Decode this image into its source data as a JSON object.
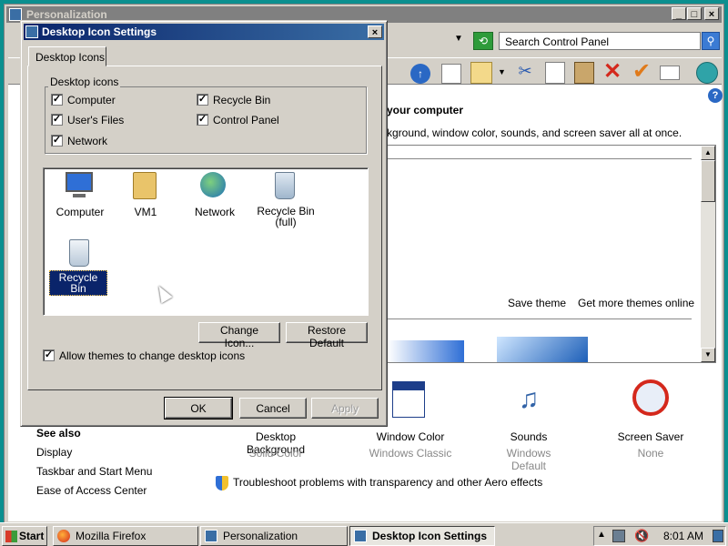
{
  "personalization_window": {
    "title": "Personalization",
    "search_placeholder": "Search Control Panel",
    "heading": "your computer",
    "subheading": "kground, window color, sounds, and screen saver all at once.",
    "save_theme": "Save theme",
    "more_themes": "Get more themes online",
    "see_also_heading": "See also",
    "see_also": [
      "Display",
      "Taskbar and Start Menu",
      "Ease of Access Center"
    ],
    "settings": [
      {
        "label": "Desktop Background",
        "value": "Solid Color",
        "icon": "desktop-background-icon"
      },
      {
        "label": "Window Color",
        "value": "Windows Classic",
        "icon": "window-color-icon"
      },
      {
        "label": "Sounds",
        "value": "Windows Default",
        "icon": "sounds-icon"
      },
      {
        "label": "Screen Saver",
        "value": "None",
        "icon": "screen-saver-icon"
      }
    ],
    "troubleshoot_link": "Troubleshoot problems with transparency and other Aero effects"
  },
  "dialog": {
    "title": "Desktop Icon Settings",
    "tab_label": "Desktop Icons",
    "group_label": "Desktop icons",
    "checkboxes": [
      {
        "label": "Computer",
        "checked": true
      },
      {
        "label": "Recycle Bin",
        "checked": true
      },
      {
        "label": "User's Files",
        "checked": true
      },
      {
        "label": "Control Panel",
        "checked": true
      },
      {
        "label": "Network",
        "checked": true
      }
    ],
    "icons": [
      {
        "label": "Computer",
        "icon": "computer-icon"
      },
      {
        "label": "VM1",
        "icon": "user-folder-icon"
      },
      {
        "label": "Network",
        "icon": "network-icon"
      },
      {
        "label": "Recycle Bin (full)",
        "icon": "recycle-bin-full-icon"
      },
      {
        "label": "Recycle Bin (empty)",
        "icon": "recycle-bin-empty-icon",
        "selected": true
      }
    ],
    "change_icon_btn": "Change Icon...",
    "restore_default_btn": "Restore Default",
    "allow_themes_label": "Allow themes to change desktop icons",
    "allow_themes_checked": true,
    "ok_btn": "OK",
    "cancel_btn": "Cancel",
    "apply_btn": "Apply"
  },
  "taskbar": {
    "start_label": "Start",
    "tasks": [
      {
        "label": "Mozilla Firefox",
        "icon": "firefox-icon"
      },
      {
        "label": "Personalization",
        "icon": "personalization-icon"
      },
      {
        "label": "Desktop Icon Settings",
        "icon": "desktop-icon-settings-icon",
        "active": true
      }
    ],
    "clock": "8:01 AM"
  },
  "colors": {
    "title_active": "#0a246a",
    "title_inactive": "#808080",
    "face": "#d4d0c8",
    "desktop": "#0b8f8f"
  }
}
